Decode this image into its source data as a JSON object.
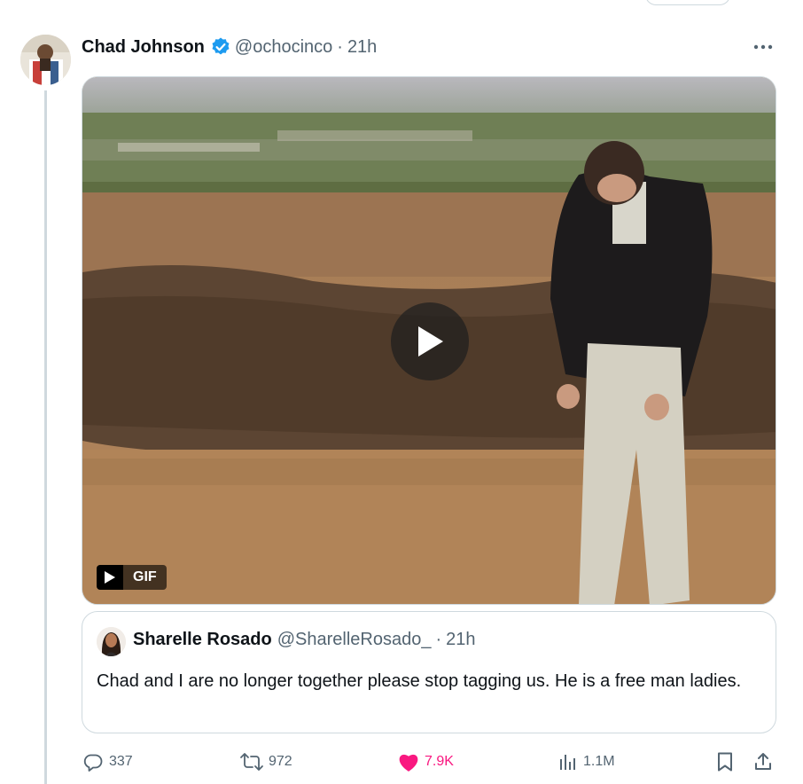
{
  "tweet": {
    "author_name": "Chad Johnson",
    "handle": "@ochocinco",
    "separator": "·",
    "time": "21h",
    "verified": true,
    "media": {
      "type": "GIF",
      "badge_label": "GIF",
      "icons": [
        "play-icon"
      ]
    },
    "quote": {
      "author_name": "Sharelle Rosado",
      "handle": "@SharelleRosado_",
      "separator": "·",
      "time": "21h",
      "text": "Chad and I are no longer together please stop tagging us. He is a free man ladies."
    },
    "actions": {
      "replies": "337",
      "reposts": "972",
      "likes": "7.9K",
      "views": "1.1M"
    }
  },
  "colors": {
    "verified_blue": "#1d9bf0",
    "like_pink": "#f91880",
    "secondary_text": "#536471",
    "border": "#cfd9de"
  }
}
